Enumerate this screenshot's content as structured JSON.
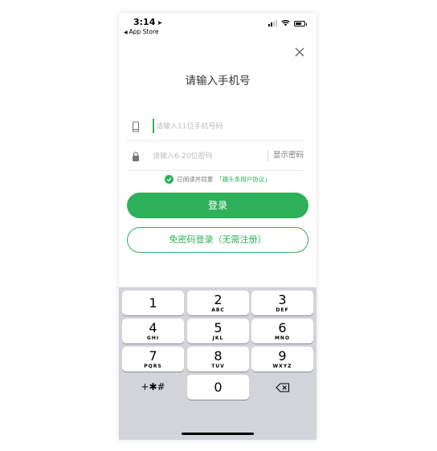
{
  "status_bar": {
    "time": "3:14",
    "back_label": "App Store"
  },
  "login": {
    "title": "请输入手机号",
    "phone_placeholder": "请输入11位手机号码",
    "password_placeholder": "请输入6-20位密码",
    "show_password": "显示密码",
    "agree_text": "已阅读并同意",
    "agree_link": "「趣头条用户协议」",
    "login_button": "登录",
    "no_password_button": "免密码登录（无需注册）"
  },
  "keyboard": {
    "keys": [
      {
        "num": "1",
        "letters": ""
      },
      {
        "num": "2",
        "letters": "ABC"
      },
      {
        "num": "3",
        "letters": "DEF"
      },
      {
        "num": "4",
        "letters": "GHI"
      },
      {
        "num": "5",
        "letters": "JKL"
      },
      {
        "num": "6",
        "letters": "MNO"
      },
      {
        "num": "7",
        "letters": "PQRS"
      },
      {
        "num": "8",
        "letters": "TUV"
      },
      {
        "num": "9",
        "letters": "WXYZ"
      }
    ],
    "symbols": "+✱#",
    "zero": "0"
  },
  "colors": {
    "accent": "#2fb05a",
    "keyboard_bg": "#d2d4da"
  }
}
